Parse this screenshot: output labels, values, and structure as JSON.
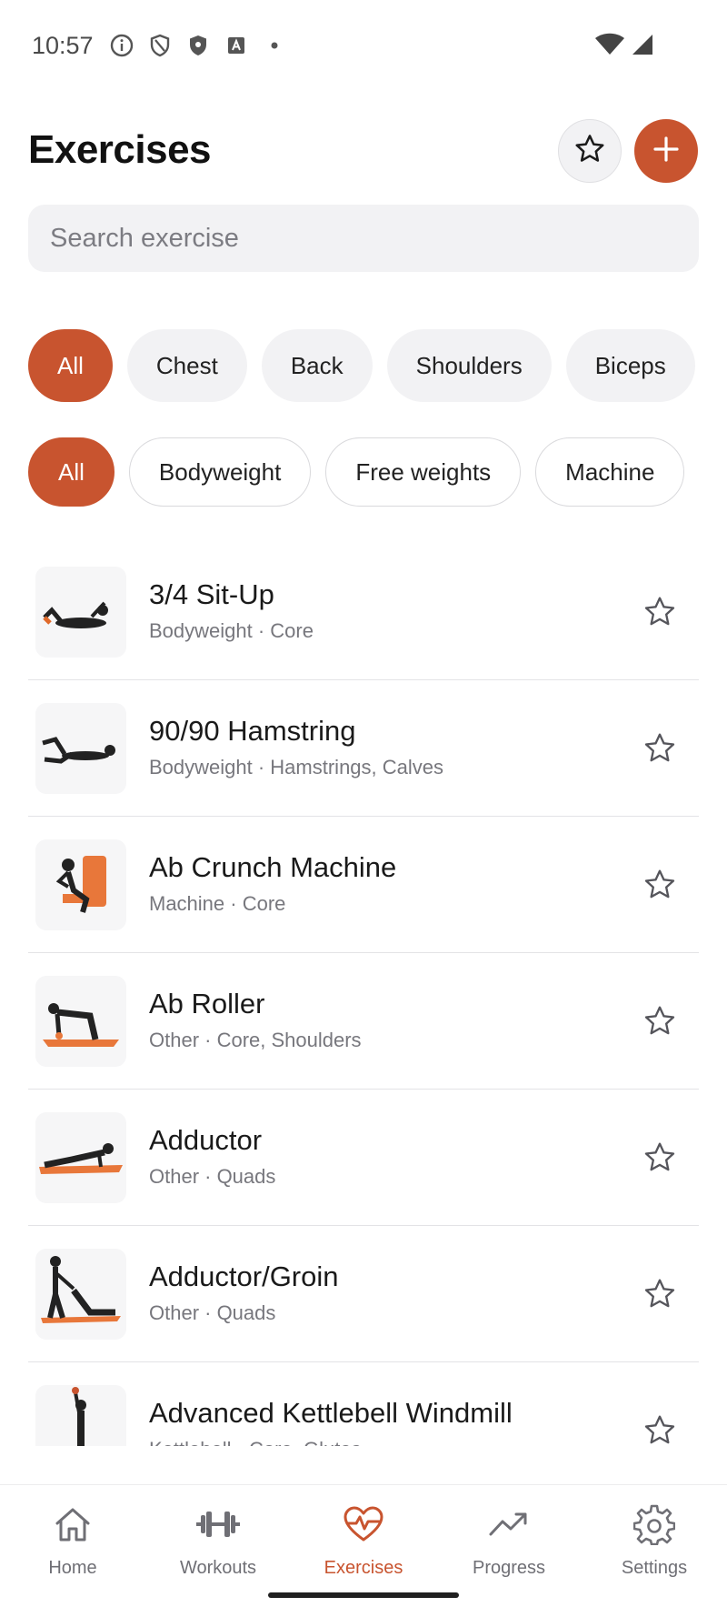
{
  "status_bar": {
    "time": "10:57"
  },
  "header": {
    "title": "Exercises"
  },
  "search": {
    "placeholder": "Search exercise",
    "value": ""
  },
  "muscle_filters": [
    {
      "label": "All",
      "active": true
    },
    {
      "label": "Chest",
      "active": false
    },
    {
      "label": "Back",
      "active": false
    },
    {
      "label": "Shoulders",
      "active": false
    },
    {
      "label": "Biceps",
      "active": false
    }
  ],
  "equipment_filters": [
    {
      "label": "All",
      "active": true
    },
    {
      "label": "Bodyweight",
      "active": false
    },
    {
      "label": "Free weights",
      "active": false
    },
    {
      "label": "Machine",
      "active": false
    }
  ],
  "exercises": [
    {
      "name": "3/4 Sit-Up",
      "details": "Bodyweight · Core"
    },
    {
      "name": "90/90 Hamstring",
      "details": "Bodyweight · Hamstrings, Calves"
    },
    {
      "name": "Ab Crunch Machine",
      "details": "Machine · Core"
    },
    {
      "name": "Ab Roller",
      "details": "Other · Core, Shoulders"
    },
    {
      "name": "Adductor",
      "details": "Other · Quads"
    },
    {
      "name": "Adductor/Groin",
      "details": "Other · Quads"
    },
    {
      "name": "Advanced Kettlebell Windmill",
      "details": "Kettlebell · Core, Glutes"
    }
  ],
  "nav": {
    "home": "Home",
    "workouts": "Workouts",
    "exercises": "Exercises",
    "progress": "Progress",
    "settings": "Settings"
  },
  "colors": {
    "accent": "#c8542f",
    "chip_bg": "#f2f2f4",
    "muted_text": "#77777d"
  }
}
